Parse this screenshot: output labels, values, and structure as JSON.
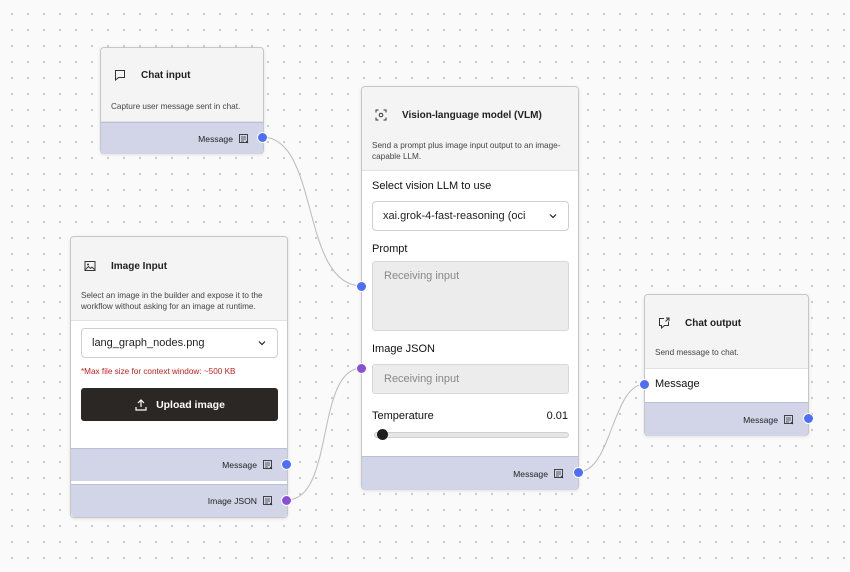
{
  "nodes": {
    "chat_input": {
      "title": "Chat input",
      "description": "Capture user message sent in chat.",
      "output_label": "Message"
    },
    "image_input": {
      "title": "Image Input",
      "description": "Select an image in the builder and expose it to the workflow without asking for an image at runtime.",
      "file_value": "lang_graph_nodes.png",
      "warning": "*Max file size for context window: ~500 KB",
      "upload_label": "Upload image",
      "output_message_label": "Message",
      "output_json_label": "Image JSON"
    },
    "vlm": {
      "title": "Vision-language model (VLM)",
      "description": "Send a prompt plus image input output to an image-capable LLM.",
      "model_label": "Select vision LLM to use",
      "model_value": "xai.grok-4-fast-reasoning (oci",
      "prompt_label": "Prompt",
      "prompt_placeholder": "Receiving input",
      "image_json_label": "Image JSON",
      "image_json_placeholder": "Receiving input",
      "temperature_label": "Temperature",
      "temperature_value": "0.01",
      "temperature_fraction": 0.01,
      "output_label": "Message"
    },
    "chat_output": {
      "title": "Chat output",
      "description": "Send message to chat.",
      "input_label": "Message",
      "output_label": "Message"
    }
  },
  "colors": {
    "port_blue": "#4f6ef7",
    "port_purple": "#8a4fd8",
    "port_bar": "#d2d5e8",
    "warning": "#c42020",
    "button_dark": "#2b2725"
  },
  "icons": {
    "chat_input": "speech-bubble-icon",
    "image_input": "image-icon",
    "vlm": "scan-eye-icon",
    "chat_output": "chat-export-icon",
    "port": "message-type-icon",
    "upload": "upload-icon",
    "dropdown": "chevron-down-icon"
  }
}
